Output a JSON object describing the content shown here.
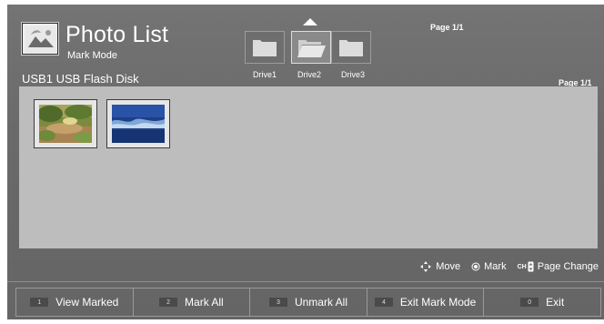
{
  "header": {
    "title": "Photo List",
    "subtitle": "Mark Mode",
    "source": "USB1 USB Flash Disk",
    "page_top": "Page 1/1",
    "page_right": "Page 1/1"
  },
  "drives": [
    {
      "label": "Drive1",
      "icon": "folder-icon",
      "selected": false
    },
    {
      "label": "Drive2",
      "icon": "folder-open-icon",
      "selected": true
    },
    {
      "label": "Drive3",
      "icon": "folder-icon",
      "selected": false
    }
  ],
  "thumbnails": [
    {
      "icon": "photo-thumbnail-garden"
    },
    {
      "icon": "photo-thumbnail-ocean"
    }
  ],
  "hints": {
    "move": "Move",
    "mark": "Mark",
    "ch_icon": "CH",
    "page_change": "Page Change"
  },
  "footer": {
    "buttons": [
      {
        "key": "1",
        "label": "View Marked"
      },
      {
        "key": "2",
        "label": "Mark All"
      },
      {
        "key": "3",
        "label": "Unmark All"
      },
      {
        "key": "4",
        "label": "Exit Mark Mode"
      },
      {
        "key": "0",
        "label": "Exit"
      }
    ]
  },
  "colors": {
    "background": "#6a6a6a",
    "content_area": "#bdbdbd",
    "text": "#ffffff"
  }
}
